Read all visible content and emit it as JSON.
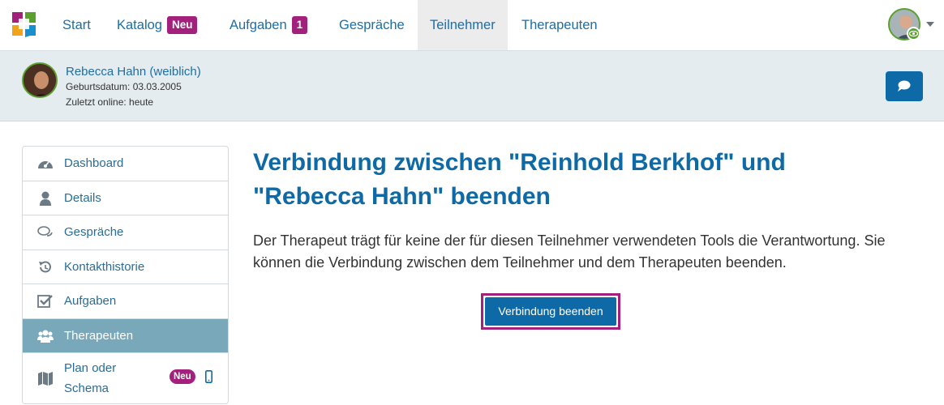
{
  "nav": {
    "items": [
      {
        "label": "Start"
      },
      {
        "label": "Katalog",
        "badge": "Neu"
      },
      {
        "label": "Aufgaben",
        "badge": "1"
      },
      {
        "label": "Gespräche"
      },
      {
        "label": "Teilnehmer",
        "active": true
      },
      {
        "label": "Therapeuten"
      }
    ]
  },
  "patient": {
    "name": "Rebecca Hahn (weiblich)",
    "birthdate": "Geburtsdatum: 03.03.2005",
    "last_online": "Zuletzt online: heute"
  },
  "sidebar": {
    "items": [
      {
        "label": "Dashboard",
        "icon": "dashboard-icon"
      },
      {
        "label": "Details",
        "icon": "user-icon"
      },
      {
        "label": "Gespräche",
        "icon": "chat-bubbles-icon"
      },
      {
        "label": "Kontakthistorie",
        "icon": "history-icon"
      },
      {
        "label": "Aufgaben",
        "icon": "checkbox-icon"
      },
      {
        "label": "Therapeuten",
        "icon": "users-icon",
        "active": true
      },
      {
        "label": "Plan oder Schema",
        "icon": "map-icon",
        "badge": "Neu"
      }
    ]
  },
  "main": {
    "title": "Verbindung zwischen \"Reinhold Berkhof\" und \"Rebecca Hahn\" beenden",
    "text": "Der Therapeut trägt für keine der für diesen Teilnehmer verwendeten Tools die Verantwortung. Sie können die Verbindung zwischen dem Teilnehmer und dem Therapeuten beenden.",
    "button_label": "Verbindung beenden"
  },
  "colors": {
    "primary": "#0e6aa7",
    "accent": "#a3207d",
    "sidebar_active": "#7aa8bb",
    "header_bg": "#e5ecf0",
    "online": "#5aa02c"
  }
}
